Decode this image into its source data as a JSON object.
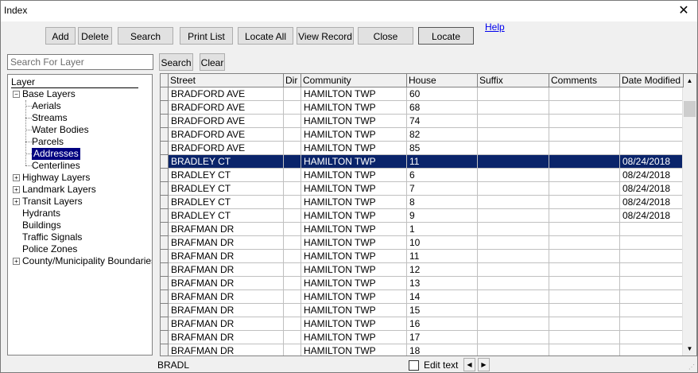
{
  "window": {
    "title": "Index"
  },
  "toolbar": {
    "add": "Add",
    "delete": "Delete",
    "search": "Search",
    "print_list": "Print List",
    "locate_all": "Locate All",
    "view_record": "View Record",
    "close": "Close",
    "locate": "Locate",
    "help": "Help"
  },
  "layer_search": {
    "placeholder": "Search For Layer",
    "value": "",
    "search_button": "Search",
    "clear_button": "Clear"
  },
  "tree": {
    "header": "Layer",
    "items": [
      {
        "label": "Base Layers",
        "level": 0,
        "expander": "minus"
      },
      {
        "label": "Aerials",
        "level": 1
      },
      {
        "label": "Streams",
        "level": 1
      },
      {
        "label": "Water Bodies",
        "level": 1
      },
      {
        "label": "Parcels",
        "level": 1
      },
      {
        "label": "Addresses",
        "level": 1,
        "selected": true
      },
      {
        "label": "Centerlines",
        "level": 1
      },
      {
        "label": "Highway Layers",
        "level": 0,
        "expander": "plus"
      },
      {
        "label": "Landmark Layers",
        "level": 0,
        "expander": "plus"
      },
      {
        "label": "Transit Layers",
        "level": 0,
        "expander": "plus"
      },
      {
        "label": "Hydrants",
        "level": 0
      },
      {
        "label": "Buildings",
        "level": 0
      },
      {
        "label": "Traffic Signals",
        "level": 0
      },
      {
        "label": "Police Zones",
        "level": 0
      },
      {
        "label": "County/Municipality Boundaries",
        "level": 0,
        "expander": "plus"
      }
    ]
  },
  "grid": {
    "columns": [
      "Street",
      "Dir",
      "Community",
      "House",
      "Suffix",
      "Comments",
      "Date Modified"
    ],
    "selected_row": 5,
    "rows": [
      [
        "BRADFORD AVE",
        "",
        "HAMILTON TWP",
        "60",
        "",
        "",
        ""
      ],
      [
        "BRADFORD AVE",
        "",
        "HAMILTON TWP",
        "68",
        "",
        "",
        ""
      ],
      [
        "BRADFORD AVE",
        "",
        "HAMILTON TWP",
        "74",
        "",
        "",
        ""
      ],
      [
        "BRADFORD AVE",
        "",
        "HAMILTON TWP",
        "82",
        "",
        "",
        ""
      ],
      [
        "BRADFORD AVE",
        "",
        "HAMILTON TWP",
        "85",
        "",
        "",
        ""
      ],
      [
        "BRADLEY CT",
        "",
        "HAMILTON TWP",
        "11",
        "",
        "",
        "08/24/2018"
      ],
      [
        "BRADLEY CT",
        "",
        "HAMILTON TWP",
        "6",
        "",
        "",
        "08/24/2018"
      ],
      [
        "BRADLEY CT",
        "",
        "HAMILTON TWP",
        "7",
        "",
        "",
        "08/24/2018"
      ],
      [
        "BRADLEY CT",
        "",
        "HAMILTON TWP",
        "8",
        "",
        "",
        "08/24/2018"
      ],
      [
        "BRADLEY CT",
        "",
        "HAMILTON TWP",
        "9",
        "",
        "",
        "08/24/2018"
      ],
      [
        "BRAFMAN DR",
        "",
        "HAMILTON TWP",
        "1",
        "",
        "",
        ""
      ],
      [
        "BRAFMAN DR",
        "",
        "HAMILTON TWP",
        "10",
        "",
        "",
        ""
      ],
      [
        "BRAFMAN DR",
        "",
        "HAMILTON TWP",
        "11",
        "",
        "",
        ""
      ],
      [
        "BRAFMAN DR",
        "",
        "HAMILTON TWP",
        "12",
        "",
        "",
        ""
      ],
      [
        "BRAFMAN DR",
        "",
        "HAMILTON TWP",
        "13",
        "",
        "",
        ""
      ],
      [
        "BRAFMAN DR",
        "",
        "HAMILTON TWP",
        "14",
        "",
        "",
        ""
      ],
      [
        "BRAFMAN DR",
        "",
        "HAMILTON TWP",
        "15",
        "",
        "",
        ""
      ],
      [
        "BRAFMAN DR",
        "",
        "HAMILTON TWP",
        "16",
        "",
        "",
        ""
      ],
      [
        "BRAFMAN DR",
        "",
        "HAMILTON TWP",
        "17",
        "",
        "",
        ""
      ],
      [
        "BRAFMAN DR",
        "",
        "HAMILTON TWP",
        "18",
        "",
        "",
        ""
      ]
    ]
  },
  "statusbar": {
    "search_text": "BRADL",
    "edit_text_label": "Edit text",
    "edit_text_checked": false
  },
  "icons": {
    "close": "close-icon",
    "scroll_up": "scroll-up-arrow-icon",
    "scroll_down": "scroll-down-arrow-icon",
    "prev": "chevron-left-icon",
    "next": "chevron-right-icon"
  },
  "colors": {
    "selection": "#0a246a",
    "tree_selection": "#000080",
    "link": "#0000ee"
  }
}
